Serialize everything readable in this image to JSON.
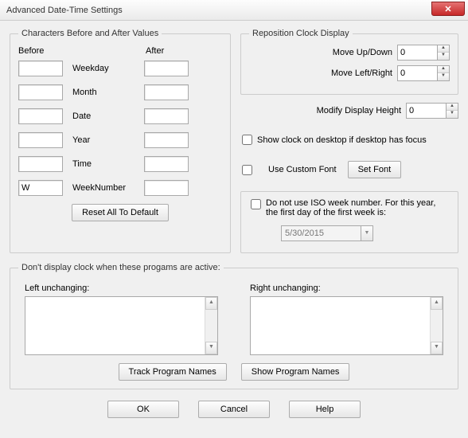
{
  "window": {
    "title": "Advanced Date-Time Settings",
    "close_glyph": "✕"
  },
  "chars": {
    "legend": "Characters Before and After Values",
    "hdr_before": "Before",
    "hdr_after": "After",
    "rows": [
      {
        "label": "Weekday",
        "before": "",
        "after": ""
      },
      {
        "label": "Month",
        "before": "",
        "after": ""
      },
      {
        "label": "Date",
        "before": "",
        "after": ""
      },
      {
        "label": "Year",
        "before": "",
        "after": ""
      },
      {
        "label": "Time",
        "before": "",
        "after": ""
      },
      {
        "label": "WeekNumber",
        "before": "W",
        "after": ""
      }
    ],
    "reset_label": "Reset All To Default"
  },
  "repos": {
    "legend": "Reposition Clock Display",
    "updown_label": "Move Up/Down",
    "updown_value": "0",
    "leftright_label": "Move Left/Right",
    "leftright_value": "0"
  },
  "modify_height": {
    "label": "Modify Display Height",
    "value": "0"
  },
  "show_desktop": {
    "label": "Show clock on desktop if desktop has focus",
    "checked": false
  },
  "custom_font": {
    "label": "Use Custom Font",
    "checked": false,
    "set_font_label": "Set Font"
  },
  "iso": {
    "label": "Do not use ISO week number.  For this year, the first day of the first week is:",
    "checked": false,
    "date_value": "5/30/2015"
  },
  "programs": {
    "legend": "Don't display clock when these progams are active:",
    "left_label": "Left unchanging:",
    "right_label": "Right unchanging:",
    "track_label": "Track Program Names",
    "show_label": "Show Program Names"
  },
  "dialog": {
    "ok": "OK",
    "cancel": "Cancel",
    "help": "Help"
  }
}
